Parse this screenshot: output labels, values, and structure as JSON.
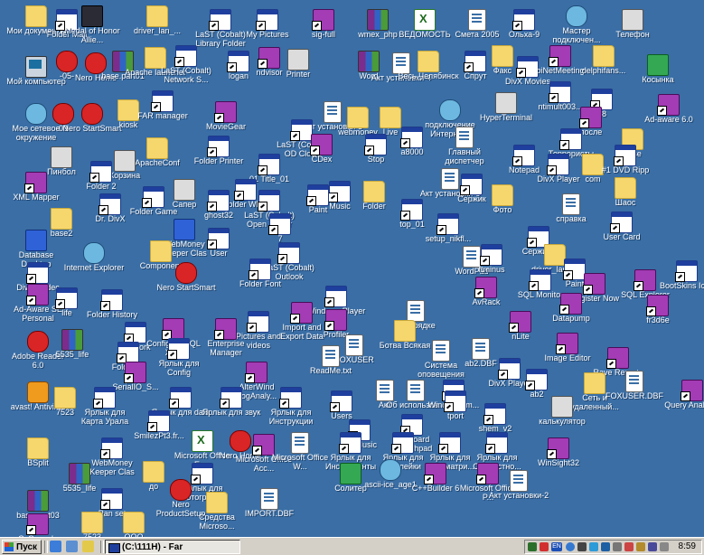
{
  "desktop_icons": [
    {
      "label": "Мои документы",
      "icon": "folder-icon"
    },
    {
      "label": "Folder Mail",
      "icon": "window-icon"
    },
    {
      "label": "Medal of Honor Allie...",
      "icon": "medal-icon"
    },
    {
      "label": "driver_lan_...",
      "icon": "folder-icon"
    },
    {
      "label": "LaST (Cobalt) Library Folder",
      "icon": "window-icon"
    },
    {
      "label": "My Pictures",
      "icon": "window-icon"
    },
    {
      "label": "sig-full",
      "icon": "app-icon"
    },
    {
      "label": "wmex_php",
      "icon": "rar-icon"
    },
    {
      "label": "ВЕДОМОСТЬ",
      "icon": "excel-icon"
    },
    {
      "label": "Смета 2005",
      "icon": "doc-icon"
    },
    {
      "label": "Ольха-9",
      "icon": "window-icon"
    },
    {
      "label": "Мастер подключен...",
      "icon": "network-icon"
    },
    {
      "label": "Телефон",
      "icon": "phone-icon"
    },
    {
      "label": "Мой компьютер",
      "icon": "computer-icon"
    },
    {
      "label": "-05-",
      "icon": "number-icon"
    },
    {
      "label": "Nero Home",
      "icon": "nero-icon"
    },
    {
      "label": "base.part01",
      "icon": "rar-icon"
    },
    {
      "label": "Apache launcher",
      "icon": "folder-icon"
    },
    {
      "label": "LaST (Cobalt) Network S...",
      "icon": "window-icon"
    },
    {
      "label": "logan",
      "icon": "window-icon"
    },
    {
      "label": "ndvisor",
      "icon": "app-icon"
    },
    {
      "label": "Printer",
      "icon": "printer-icon"
    },
    {
      "label": "Word",
      "icon": "rar-icon"
    },
    {
      "label": "Акт установки-4",
      "icon": "doc-icon"
    },
    {
      "label": "Весь Челябинск",
      "icon": "folder-icon"
    },
    {
      "label": "Спрут",
      "icon": "window-icon"
    },
    {
      "label": "Факс",
      "icon": "folder-icon"
    },
    {
      "label": "DivX Movies",
      "icon": "window-icon"
    },
    {
      "label": "biNetMeeting",
      "icon": "app-icon"
    },
    {
      "label": "delphifans...",
      "icon": "folder-icon"
    },
    {
      "label": "Косынка",
      "icon": "cards-icon"
    },
    {
      "label": "Мое сетевое окружение",
      "icon": "network-icon"
    },
    {
      "label": "-09-",
      "icon": "number-icon"
    },
    {
      "label": "Nero StartSmart",
      "icon": "nero-icon"
    },
    {
      "label": "kiosk",
      "icon": "folder-icon"
    },
    {
      "label": "FAR manager",
      "icon": "window-icon"
    },
    {
      "label": "MovieGear",
      "icon": "app-icon"
    },
    {
      "label": "Акт установки-5",
      "icon": "doc-icon"
    },
    {
      "label": "webmoney",
      "icon": "folder-icon"
    },
    {
      "label": "Live",
      "icon": "folder-icon"
    },
    {
      "label": "подключение Интернету",
      "icon": "network-icon"
    },
    {
      "label": "HyperTerminal",
      "icon": "phone-icon"
    },
    {
      "label": "ntimult003...",
      "icon": "window-icon"
    },
    {
      "label": "88",
      "icon": "window-icon"
    },
    {
      "label": "после",
      "icon": "app-icon"
    },
    {
      "label": "Ad-aware 6.0",
      "icon": "app-icon"
    },
    {
      "label": "Пинбол",
      "icon": "pinball-icon"
    },
    {
      "label": "ApacheConf",
      "icon": "folder-icon"
    },
    {
      "label": "Folder Printer",
      "icon": "window-icon"
    },
    {
      "label": "LaST (Cobalt) OD Clock",
      "icon": "window-icon"
    },
    {
      "label": "CDex",
      "icon": "app-icon"
    },
    {
      "label": "Stop",
      "icon": "window-icon"
    },
    {
      "label": "a8000",
      "icon": "window-icon"
    },
    {
      "label": "Главный диспетчер",
      "icon": "doc-icon"
    },
    {
      "label": "Террористы",
      "icon": "window-icon"
    },
    {
      "label": "base",
      "icon": "folder-icon"
    },
    {
      "label": "XML Mapper",
      "icon": "app-icon"
    },
    {
      "label": "Корзина",
      "icon": "recycle-bin-icon"
    },
    {
      "label": "Folder 2",
      "icon": "window-icon"
    },
    {
      "label": "01 Title_01",
      "icon": "window-icon"
    },
    {
      "label": "Notepad",
      "icon": "window-icon"
    },
    {
      "label": "DivX Player",
      "icon": "window-icon"
    },
    {
      "label": "com",
      "icon": "folder-icon"
    },
    {
      "label": "#1 DVD Ripp",
      "icon": "window-icon"
    },
    {
      "label": "Шаоc",
      "icon": "folder-icon"
    },
    {
      "label": "Сапер",
      "icon": "minesweeper-icon"
    },
    {
      "label": "Folder WMP",
      "icon": "window-icon"
    },
    {
      "label": "Music",
      "icon": "window-icon"
    },
    {
      "label": "Folder",
      "icon": "folder-icon"
    },
    {
      "label": "Акт установки-6",
      "icon": "doc-icon"
    },
    {
      "label": "Сержик",
      "icon": "window-icon"
    },
    {
      "label": "Фото",
      "icon": "folder-icon"
    },
    {
      "label": "Dr. DivX",
      "icon": "window-icon"
    },
    {
      "label": "Folder Game",
      "icon": "window-icon"
    },
    {
      "label": "ghost32",
      "icon": "window-icon"
    },
    {
      "label": "LaST (Cobalt) Open Folder",
      "icon": "window-icon"
    },
    {
      "label": "Paint",
      "icon": "window-icon"
    },
    {
      "label": "top_01",
      "icon": "window-icon"
    },
    {
      "label": "справка",
      "icon": "doc-icon"
    },
    {
      "label": "base2",
      "icon": "folder-icon"
    },
    {
      "label": "WebMoney Keeper Clas",
      "icon": "webmoney-icon"
    },
    {
      "label": "7",
      "icon": "window-icon"
    },
    {
      "label": "setup_nikfl...",
      "icon": "window-icon"
    },
    {
      "label": "Сержик2",
      "icon": "window-icon"
    },
    {
      "label": "User Card",
      "icon": "window-icon"
    },
    {
      "label": "Database Desktop",
      "icon": "database-icon"
    },
    {
      "label": "Internet Explorer",
      "icon": "ie-icon"
    },
    {
      "label": "User",
      "icon": "window-icon"
    },
    {
      "label": "LaST (Cobalt) Outlook",
      "icon": "window-icon"
    },
    {
      "label": "Component",
      "icon": "folder-icon"
    },
    {
      "label": "Folder Font",
      "icon": "window-icon"
    },
    {
      "label": "driver_lan_...",
      "icon": "folder-icon"
    },
    {
      "label": "Paint",
      "icon": "window-icon"
    },
    {
      "label": "WordPad",
      "icon": "doc-icon"
    },
    {
      "label": "BootSkins Icon",
      "icon": "window-icon"
    },
    {
      "label": "DivX Codec",
      "icon": "window-icon"
    },
    {
      "label": "ftminus",
      "icon": "window-icon"
    },
    {
      "label": "Ad-Aware SE Personal",
      "icon": "app-icon"
    },
    {
      "label": "life",
      "icon": "window-icon"
    },
    {
      "label": "Nero StartSmart",
      "icon": "nero-icon"
    },
    {
      "label": "Windows Player",
      "icon": "window-icon"
    },
    {
      "label": "AvRack",
      "icon": "app-icon"
    },
    {
      "label": "SQL Monitor",
      "icon": "window-icon"
    },
    {
      "label": "Register Now",
      "icon": "app-icon"
    },
    {
      "label": "SQL Explorer",
      "icon": "app-icon"
    },
    {
      "label": "Folder History",
      "icon": "window-icon"
    },
    {
      "label": "Profiler",
      "icon": "app-icon"
    },
    {
      "label": "О порядке",
      "icon": "doc-icon"
    },
    {
      "label": "Datapump",
      "icon": "app-icon"
    },
    {
      "label": "fr3d6e",
      "icon": "app-icon"
    },
    {
      "label": "Pictures and videos",
      "icon": "window-icon"
    },
    {
      "label": "Import and Export Data",
      "icon": "app-icon"
    },
    {
      "label": "nLite",
      "icon": "app-icon"
    },
    {
      "label": "Adobe Reader 6.0",
      "icon": "adobe-icon"
    },
    {
      "label": "5535_life",
      "icon": "rar-icon"
    },
    {
      "label": "Network",
      "icon": "window-icon"
    },
    {
      "label": "Configure SQL XML",
      "icon": "app-icon"
    },
    {
      "label": "Enterprise Manager",
      "icon": "app-icon"
    },
    {
      "label": "FOXUSER",
      "icon": "doc-icon"
    },
    {
      "label": "Ботва Всякая",
      "icon": "folder-icon"
    },
    {
      "label": "Система оповещения",
      "icon": "doc-icon"
    },
    {
      "label": "ab2.DBF",
      "icon": "doc-icon"
    },
    {
      "label": "Image Editor",
      "icon": "app-icon"
    },
    {
      "label": "Folder IE",
      "icon": "window-icon"
    },
    {
      "label": "Ярлык для Config",
      "icon": "window-icon"
    },
    {
      "label": "ReadMe.txt",
      "icon": "doc-icon"
    },
    {
      "label": "DivX Player",
      "icon": "window-icon"
    },
    {
      "label": "Rave Reports",
      "icon": "app-icon"
    },
    {
      "label": "SerialIO_S...",
      "icon": "app-icon"
    },
    {
      "label": "AlterWind LogAnaly...",
      "icon": "app-icon"
    },
    {
      "label": "Акт",
      "icon": "doc-icon"
    },
    {
      "label": "Об использов...",
      "icon": "doc-icon"
    },
    {
      "label": "Windows_m...",
      "icon": "window-icon"
    },
    {
      "label": "ab2",
      "icon": "window-icon"
    },
    {
      "label": "Сеть и удаленный...",
      "icon": "folder-icon"
    },
    {
      "label": "avast! Antivirus",
      "icon": "avast-icon"
    },
    {
      "label": "7523",
      "icon": "folder-icon"
    },
    {
      "label": "Ярлык для Карта Урала",
      "icon": "window-icon"
    },
    {
      "label": "Ярлык для data",
      "icon": "window-icon"
    },
    {
      "label": "Ярлык для звук",
      "icon": "window-icon"
    },
    {
      "label": "Ярлык для Инструкции",
      "icon": "window-icon"
    },
    {
      "label": "Users",
      "icon": "window-icon"
    },
    {
      "label": "tport",
      "icon": "window-icon"
    },
    {
      "label": "калькулятор",
      "icon": "calculator-icon"
    },
    {
      "label": "FOXUSER.DBF",
      "icon": "doc-icon"
    },
    {
      "label": "Query Analyzer",
      "icon": "app-icon"
    },
    {
      "label": "SmilezPt3.fr...",
      "icon": "window-icon"
    },
    {
      "label": "My Music",
      "icon": "window-icon"
    },
    {
      "label": "Keyboard Launchpad",
      "icon": "window-icon"
    },
    {
      "label": "shem_v2",
      "icon": "window-icon"
    },
    {
      "label": "BSplit",
      "icon": "folder-icon"
    },
    {
      "label": "WebMoney Keeper Clas",
      "icon": "window-icon"
    },
    {
      "label": "Microsoft Office Ex...",
      "icon": "excel-icon"
    },
    {
      "label": "Nero Home",
      "icon": "nero-icon"
    },
    {
      "label": "Microsoft Office Acc...",
      "icon": "app-icon"
    },
    {
      "label": "Microsoft Office W...",
      "icon": "doc-icon"
    },
    {
      "label": "Ярлык для Инструменты",
      "icon": "window-icon"
    },
    {
      "label": "Ярлык для Наклейки",
      "icon": "window-icon"
    },
    {
      "label": "Ярлык для Просматри...",
      "icon": "window-icon"
    },
    {
      "label": "Ярлык для Совместно...",
      "icon": "window-icon"
    },
    {
      "label": "WinSight32",
      "icon": "app-icon"
    },
    {
      "label": "5535_life",
      "icon": "rar-icon"
    },
    {
      "label": "до",
      "icon": "folder-icon"
    },
    {
      "label": "Ярлык для Фотограф...",
      "icon": "window-icon"
    },
    {
      "label": "Солитер",
      "icon": "cards-icon"
    },
    {
      "label": "ascii-ice_age1",
      "icon": "ie-icon"
    },
    {
      "label": "C++Builder 6",
      "icon": "app-icon"
    },
    {
      "label": "Microsoft Office P...",
      "icon": "app-icon"
    },
    {
      "label": "Акт установки-2",
      "icon": "doc-icon"
    },
    {
      "label": "base.part03",
      "icon": "rar-icon"
    },
    {
      "label": "Pan set",
      "icon": "window-icon"
    },
    {
      "label": "Nero ProductSetup",
      "icon": "nero-icon"
    },
    {
      "label": "Средства Microso...",
      "icon": "folder-icon"
    },
    {
      "label": "IMPORT.DBF",
      "icon": "doc-icon"
    },
    {
      "label": "CyConsole",
      "icon": "app-icon"
    },
    {
      "label": "7523",
      "icon": "folder-icon"
    },
    {
      "label": "ООО",
      "icon": "folder-icon"
    }
  ],
  "taskbar": {
    "start_label": "Пуск",
    "task_label": "(C:\\111H) - Far",
    "clock": "8:59",
    "tray_lang": "EN"
  }
}
